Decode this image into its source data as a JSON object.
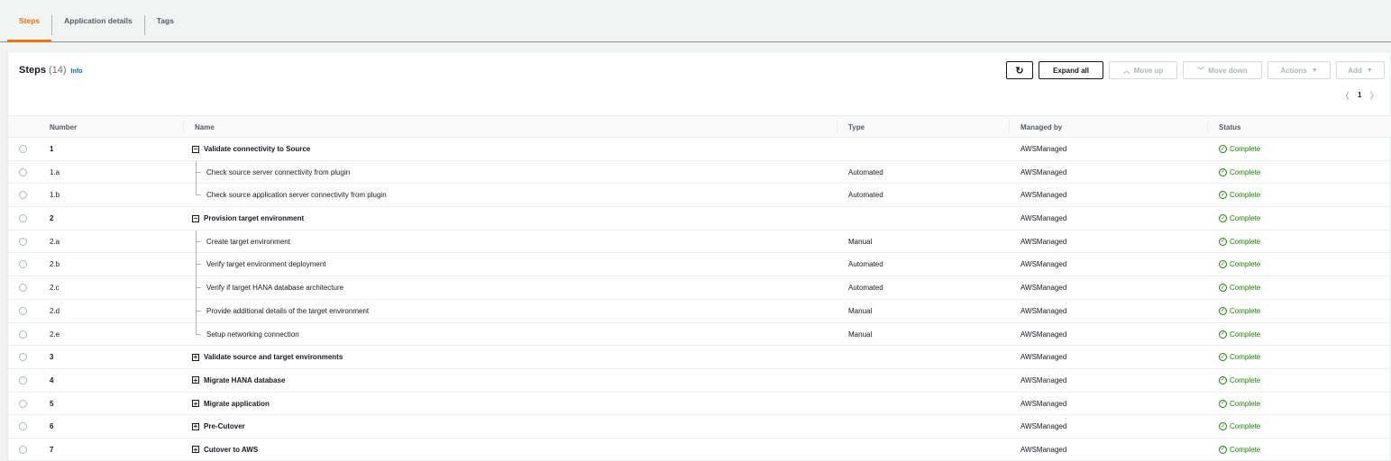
{
  "tabs": [
    {
      "label": "Steps",
      "active": true
    },
    {
      "label": "Application details",
      "active": false
    },
    {
      "label": "Tags",
      "active": false
    }
  ],
  "header": {
    "title": "Steps",
    "count": "(14)",
    "info": "Info"
  },
  "toolbar": {
    "refresh_icon": "refresh-icon",
    "expand_all": "Expand all",
    "move_up": "Move up",
    "move_down": "Move down",
    "actions": "Actions",
    "add": "Add"
  },
  "pagination": {
    "page": "1"
  },
  "columns": {
    "number": "Number",
    "name": "Name",
    "type": "Type",
    "managed_by": "Managed by",
    "status": "Status"
  },
  "rows": [
    {
      "number": "1",
      "name": "Validate connectivity to Source",
      "type": "",
      "managed_by": "AWSManaged",
      "status": "Complete",
      "level": 0,
      "toggle": "−"
    },
    {
      "number": "1.a",
      "name": "Check source server connectivity from plugin",
      "type": "Automated",
      "managed_by": "AWSManaged",
      "status": "Complete",
      "level": 1
    },
    {
      "number": "1.b",
      "name": "Check source application server connectivity from plugin",
      "type": "Automated",
      "managed_by": "AWSManaged",
      "status": "Complete",
      "level": 1,
      "last": true
    },
    {
      "number": "2",
      "name": "Provision target environment",
      "type": "",
      "managed_by": "AWSManaged",
      "status": "Complete",
      "level": 0,
      "toggle": "−"
    },
    {
      "number": "2.a",
      "name": "Create target environment",
      "type": "Manual",
      "managed_by": "AWSManaged",
      "status": "Complete",
      "level": 1
    },
    {
      "number": "2.b",
      "name": "Verify target environment deployment",
      "type": "Automated",
      "managed_by": "AWSManaged",
      "status": "Complete",
      "level": 1
    },
    {
      "number": "2.c",
      "name": "Verify if target HANA database architecture",
      "type": "Automated",
      "managed_by": "AWSManaged",
      "status": "Complete",
      "level": 1
    },
    {
      "number": "2.d",
      "name": "Provide additional details of the target environment",
      "type": "Manual",
      "managed_by": "AWSManaged",
      "status": "Complete",
      "level": 1
    },
    {
      "number": "2.e",
      "name": "Setup networking connection",
      "type": "Manual",
      "managed_by": "AWSManaged",
      "status": "Complete",
      "level": 1,
      "last": true
    },
    {
      "number": "3",
      "name": "Validate source and target environments",
      "type": "",
      "managed_by": "AWSManaged",
      "status": "Complete",
      "level": 0,
      "toggle": "+"
    },
    {
      "number": "4",
      "name": "Migrate HANA database",
      "type": "",
      "managed_by": "AWSManaged",
      "status": "Complete",
      "level": 0,
      "toggle": "+"
    },
    {
      "number": "5",
      "name": "Migrate application",
      "type": "",
      "managed_by": "AWSManaged",
      "status": "Complete",
      "level": 0,
      "toggle": "+"
    },
    {
      "number": "6",
      "name": "Pre-Cutover",
      "type": "",
      "managed_by": "AWSManaged",
      "status": "Complete",
      "level": 0,
      "toggle": "+"
    },
    {
      "number": "7",
      "name": "Cutover to AWS",
      "type": "",
      "managed_by": "AWSManaged",
      "status": "Complete",
      "level": 0,
      "toggle": "+"
    }
  ],
  "colors": {
    "accent": "#ec7211",
    "link": "#0073bb",
    "success": "#1d8102"
  }
}
